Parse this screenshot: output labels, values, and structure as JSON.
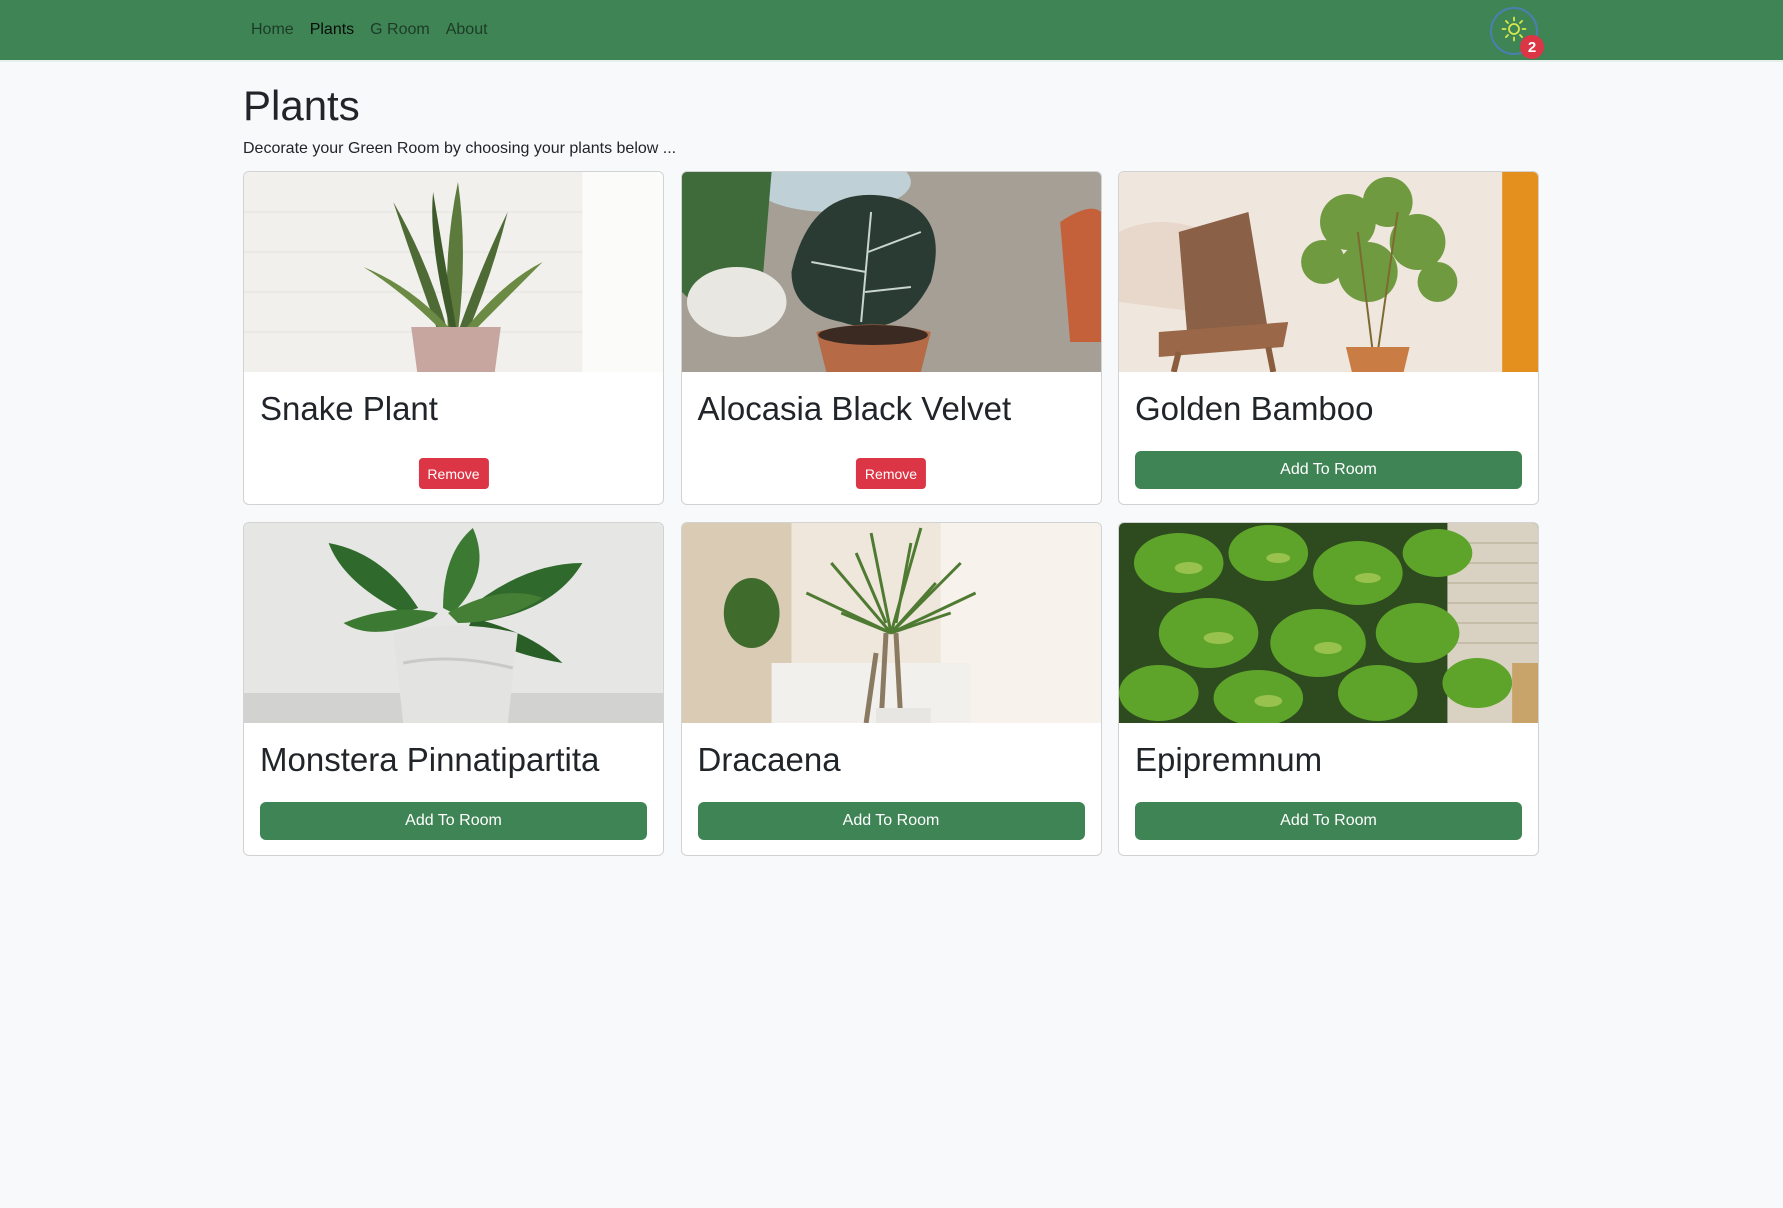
{
  "nav": {
    "links": [
      {
        "label": "Home",
        "active": false
      },
      {
        "label": "Plants",
        "active": true
      },
      {
        "label": "G Room",
        "active": false
      },
      {
        "label": "About",
        "active": false
      }
    ],
    "room_icon": "sun-icon",
    "room_count": "2"
  },
  "page": {
    "title": "Plants",
    "subtitle": "Decorate your Green Room by choosing your plants below ..."
  },
  "plants": [
    {
      "name": "Snake Plant",
      "action": "Remove",
      "in_room": true,
      "image": "snake-plant-image"
    },
    {
      "name": "Alocasia Black Velvet",
      "action": "Remove",
      "in_room": true,
      "image": "alocasia-image"
    },
    {
      "name": "Golden Bamboo",
      "action": "Add To Room",
      "in_room": false,
      "image": "golden-bamboo-image"
    },
    {
      "name": "Monstera Pinnatipartita",
      "action": "Add To Room",
      "in_room": false,
      "image": "monstera-image"
    },
    {
      "name": "Dracaena",
      "action": "Add To Room",
      "in_room": false,
      "image": "dracaena-image"
    },
    {
      "name": "Epipremnum",
      "action": "Add To Room",
      "in_room": false,
      "image": "epipremnum-image"
    }
  ],
  "colors": {
    "navbar": "#3f8455",
    "primary_button": "#3f8455",
    "remove_button": "#dc3545",
    "badge": "#dc3545",
    "background": "#f8f9fa"
  }
}
